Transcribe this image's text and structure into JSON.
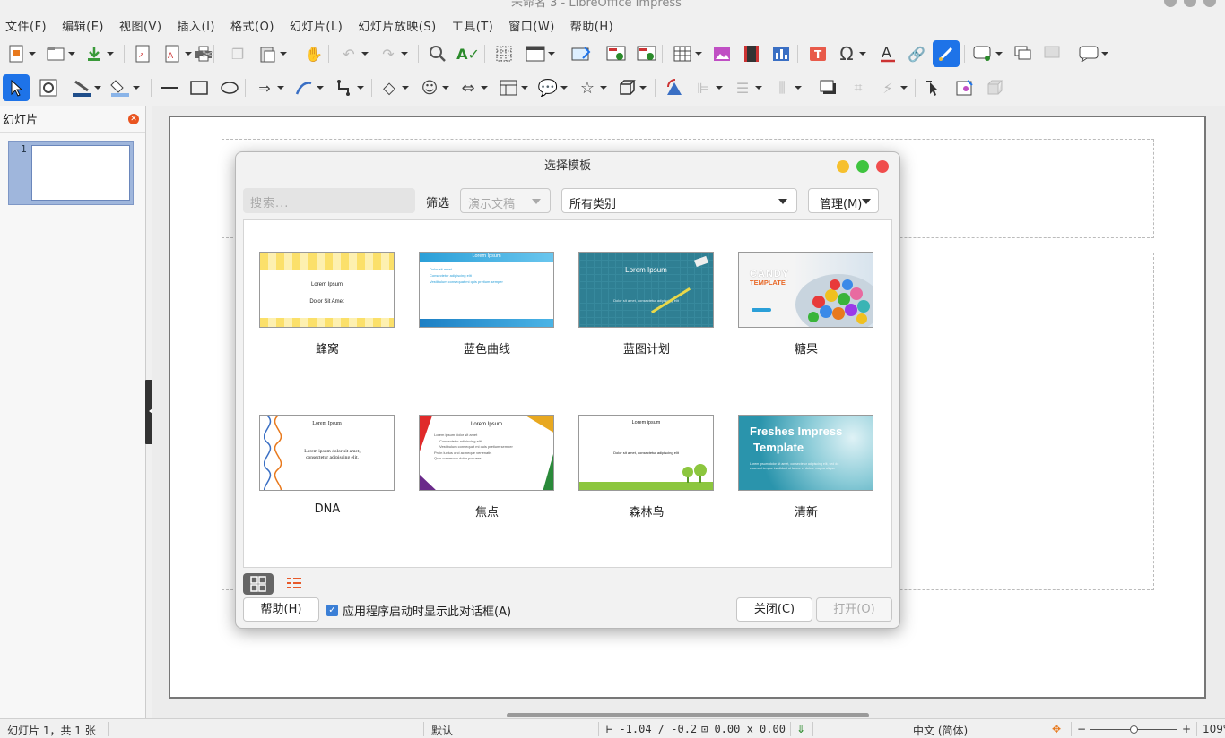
{
  "window": {
    "title": "未命名 3 - LibreOffice Impress"
  },
  "menu": [
    "文件(F)",
    "编辑(E)",
    "视图(V)",
    "插入(I)",
    "格式(O)",
    "幻灯片(L)",
    "幻灯片放映(S)",
    "工具(T)",
    "窗口(W)",
    "帮助(H)"
  ],
  "sidebar": {
    "title": "幻灯片",
    "slide_number": "1"
  },
  "status": {
    "slide_info": "幻灯片 1，共 1 张",
    "layout": "默认",
    "position": "-1.04 / -0.2",
    "size": "0.00 x 0.00",
    "language": "中文 (简体)",
    "zoom": "109"
  },
  "dialog": {
    "title": "选择模板",
    "search_placeholder": "搜索...",
    "filter_label": "筛选",
    "filter_type": "演示文稿",
    "category": "所有类别",
    "manage": "管理(M)",
    "templates": [
      {
        "name": "蜂窝",
        "l1": "Lorem Ipsum",
        "l2": "Dolor Sit Amet"
      },
      {
        "name": "蓝色曲线",
        "l1": "Lorem Ipsum",
        "b1": "Dolor sit amet",
        "b2": "Consectetur adipiscing elit",
        "b3": "Vestibulum consequat mi quis pretium semper"
      },
      {
        "name": "蓝图计划",
        "l1": "Lorem Ipsum",
        "l2": "Dolor sit amet, consectetur adipiscing elit"
      },
      {
        "name": "糖果",
        "l1": "CANDY",
        "l2": "TEMPLATE"
      },
      {
        "name": "DNA",
        "l1": "Lorem Ipsum",
        "l2": "Lorem ipsum dolor sit amet,",
        "l3": "consectetur adipiscing elit."
      },
      {
        "name": "焦点",
        "l1": "Lorem Ipsum",
        "b1": "Lorem ipsum dolor sit amet",
        "b2": "Consectetur adipiscing elit",
        "b3": "Vestibulum consequat mi quis pretium semper",
        "b4": "Proin luctus orci ac neque venenatis",
        "b5": "Quis commodo dolor posuere."
      },
      {
        "name": "森林鸟",
        "l1": "Lorem ipsum",
        "l2": "Dolor sit amet, consectetur adipiscing elit"
      },
      {
        "name": "清新",
        "l1": "Freshes Impress",
        "l2": "Template",
        "l3": "Lorem ipsum dolor sit amet, consectetur adipiscing elit, sed do eiusmod tempor incididunt ut labore et dolore magna aliqua"
      }
    ],
    "help": "帮助(H)",
    "show_on_startup": "应用程序启动时显示此对话框(A)",
    "close": "关闭(C)",
    "open": "打开(O)"
  }
}
